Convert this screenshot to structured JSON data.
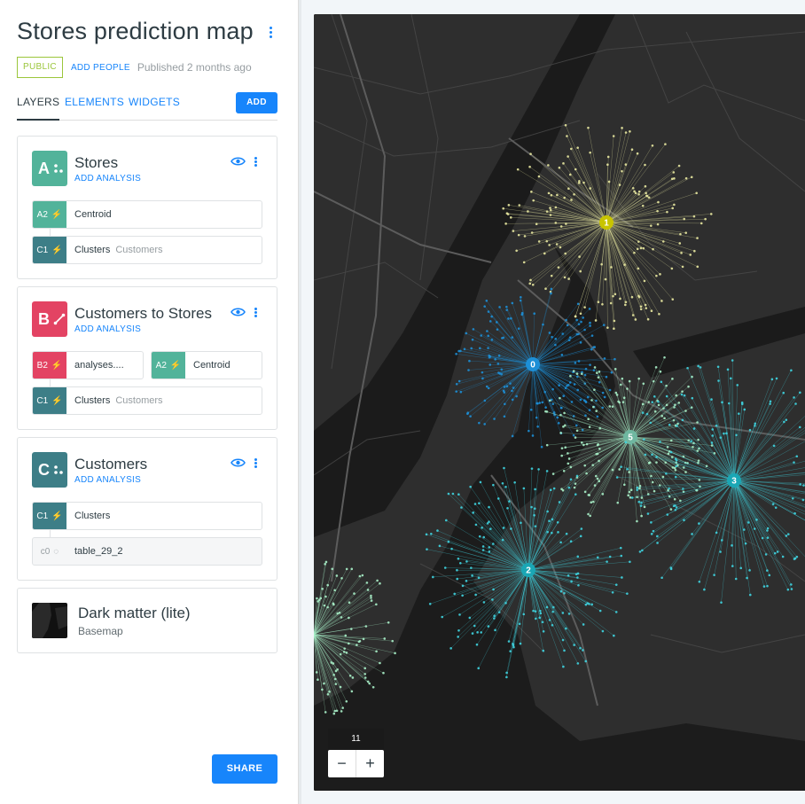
{
  "header": {
    "title": "Stores prediction map",
    "visibility": "PUBLIC",
    "add_people": "ADD PEOPLE",
    "published": "Published 2 months ago"
  },
  "tabs": {
    "layers": "LAYERS",
    "elements": "ELEMENTS",
    "widgets": "WIDGETS",
    "add": "ADD"
  },
  "layers": [
    {
      "letter": "A",
      "name": "Stores",
      "add_analysis": "ADD ANALYSIS",
      "color": "#52b39a",
      "nodes": [
        {
          "id": "A2",
          "label": "Centroid",
          "sub": ""
        },
        {
          "id": "C1",
          "label": "Clusters",
          "sub": "Customers"
        }
      ]
    },
    {
      "letter": "B",
      "name": "Customers to Stores",
      "add_analysis": "ADD ANALYSIS",
      "color": "#e34363",
      "nodes": [
        {
          "id": "B2",
          "label": "analyses....",
          "sub": ""
        },
        {
          "id": "A2",
          "label": "Centroid",
          "sub": ""
        },
        {
          "id": "C1",
          "label": "Clusters",
          "sub": "Customers"
        }
      ]
    },
    {
      "letter": "C",
      "name": "Customers",
      "add_analysis": "ADD ANALYSIS",
      "color": "#3d7e87",
      "nodes": [
        {
          "id": "C1",
          "label": "Clusters",
          "sub": ""
        },
        {
          "id": "c0",
          "label": "table_29_2",
          "sub": ""
        }
      ]
    }
  ],
  "basemap": {
    "name": "Dark matter (lite)",
    "sub": "Basemap"
  },
  "share": "SHARE",
  "map": {
    "zoom": "11",
    "zoom_out": "−",
    "zoom_in": "+",
    "cluster_labels": [
      "1",
      "0",
      "5",
      "3",
      "2"
    ]
  },
  "colors": {
    "accent": "#1785fb",
    "public": "#9bc63b",
    "green_node": "#52b39a",
    "teal_node": "#3d7e87",
    "pink_node": "#e34363",
    "cluster_yellow": "#e8e8a0",
    "cluster_blue": "#1d8fd6",
    "cluster_cyan": "#3fd4e0",
    "cluster_mint": "#a8f0c8"
  }
}
